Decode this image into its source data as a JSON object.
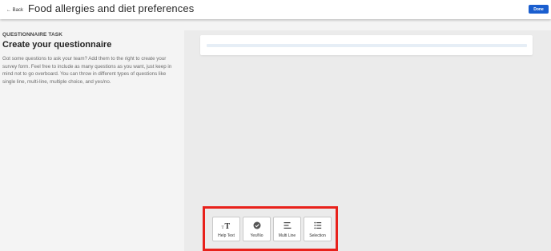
{
  "header": {
    "back_label": "← Back",
    "title": "Food allergies and diet preferences",
    "done_label": "Done"
  },
  "task": {
    "eyebrow": "QUESTIONNAIRE TASK",
    "heading": "Create your questionnaire",
    "description": "Got some questions to ask your team? Add them to the right to create your survey form. Feel free to include as many questions as you want, just keep in mind not to go overboard. You can throw in different types of questions like single line, multi-line, multiple choice, and yes/no."
  },
  "toolbox": {
    "tools": [
      {
        "label": "Help Text",
        "icon": "text-size-icon"
      },
      {
        "label": "Yes/No",
        "icon": "check-circle-icon"
      },
      {
        "label": "Multi Line",
        "icon": "align-left-icon"
      },
      {
        "label": "Selection",
        "icon": "list-icon"
      }
    ]
  },
  "colors": {
    "accent": "#1a5ecf",
    "highlight": "#e8211b",
    "workspace": "#ebebeb",
    "page_background": "#f4f4f4"
  }
}
